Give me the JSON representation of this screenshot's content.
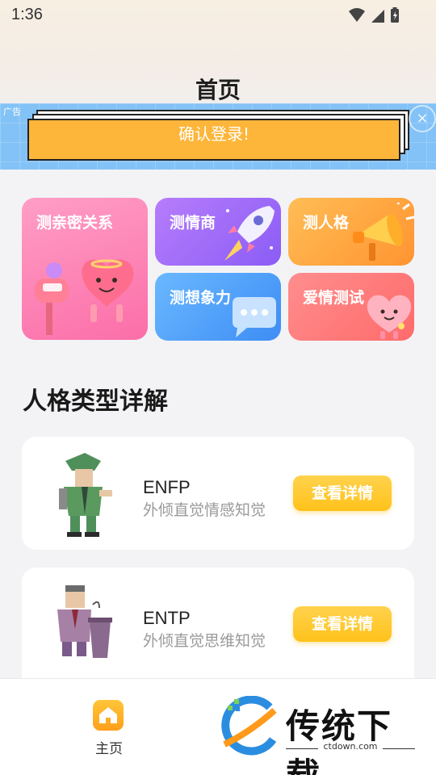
{
  "status": {
    "time": "1:36"
  },
  "header": {
    "title": "首页"
  },
  "ad": {
    "tag": "广告",
    "button_label": "确认登录!",
    "close_glyph": "×"
  },
  "tests": [
    {
      "label": "测亲密关系",
      "icon": "mailbox-hearts-icon",
      "color": "#fb6ea8"
    },
    {
      "label": "测情商",
      "icon": "rocket-icon",
      "color": "#8b5cf6"
    },
    {
      "label": "测人格",
      "icon": "megaphone-icon",
      "color": "#ff9431"
    },
    {
      "label": "测想象力",
      "icon": "speech-bubble-icon",
      "color": "#3d8df5"
    },
    {
      "label": "爱情测试",
      "icon": "heart-character-icon",
      "color": "#ff6b6b"
    }
  ],
  "section": {
    "title": "人格类型详解"
  },
  "personalities": [
    {
      "code": "ENFP",
      "desc": "外倾直觉情感知觉",
      "button": "查看详情",
      "avatar": "explorer-avatar-icon"
    },
    {
      "code": "ENTP",
      "desc": "外倾直觉思维知觉",
      "button": "查看详情",
      "avatar": "speaker-avatar-icon"
    }
  ],
  "nav": {
    "home_label": "主页",
    "home_icon": "home-icon"
  },
  "watermark": {
    "brand": "传统下载",
    "url": "ctdown.com"
  },
  "colors": {
    "accent": "#ffc21a",
    "ad_bg": "#83c2f6",
    "ad_button": "#fdb63a"
  }
}
